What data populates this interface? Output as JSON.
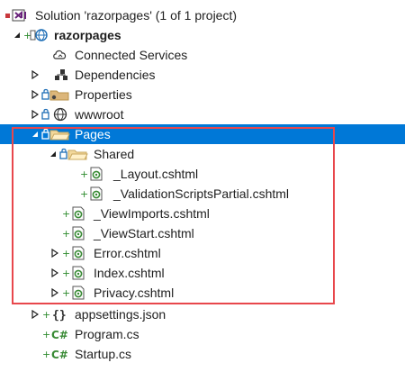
{
  "solution_explorer": {
    "solution_label": "Solution 'razorpages' (1 of 1 project)",
    "project_label": "razorpages",
    "connected_services": "Connected Services",
    "dependencies": "Dependencies",
    "properties": "Properties",
    "wwwroot": "wwwroot",
    "pages": "Pages",
    "shared": "Shared",
    "layout": "_Layout.cshtml",
    "validation_partial": "_ValidationScriptsPartial.cshtml",
    "view_imports": "_ViewImports.cshtml",
    "view_start": "_ViewStart.cshtml",
    "error": "Error.cshtml",
    "index": "Index.cshtml",
    "privacy": "Privacy.cshtml",
    "appsettings": "appsettings.json",
    "program": "Program.cs",
    "startup": "Startup.cs",
    "selected_item": "Pages"
  },
  "colors": {
    "selection": "#0078d7",
    "highlight_border": "#e8474c",
    "added_glyph": "#2e8b2e",
    "csharp_green": "#388a34"
  }
}
